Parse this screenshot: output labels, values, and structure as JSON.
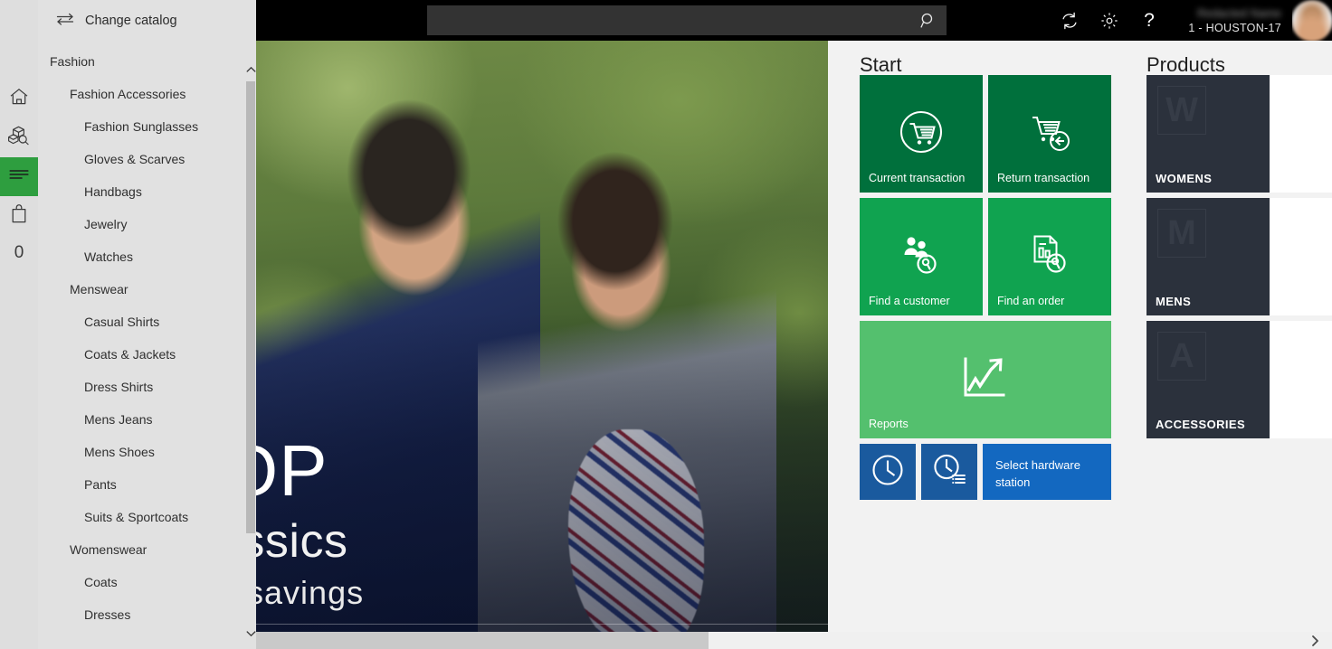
{
  "topbar": {
    "search": {
      "value": "",
      "placeholder": "",
      "icon": "search-icon"
    },
    "refresh_icon": "refresh-icon",
    "settings_icon": "gear-icon",
    "help_icon": "question-mark-icon",
    "user_name": "Redacted Name",
    "user_terminal": "1 - HOUSTON-17"
  },
  "rail": {
    "home_icon": "home-icon",
    "products_icon": "product-search-icon",
    "list_icon": "list-lines-icon",
    "bag_icon": "shopping-bag-icon",
    "count": "0"
  },
  "nav": {
    "menu_icon": "hamburger-icon",
    "swap_icon": "swap-arrows-icon",
    "change_catalog_label": "Change catalog",
    "items": [
      {
        "label": "Fashion",
        "level": 0
      },
      {
        "label": "Fashion Accessories",
        "level": 1
      },
      {
        "label": "Fashion Sunglasses",
        "level": 2
      },
      {
        "label": "Gloves & Scarves",
        "level": 2
      },
      {
        "label": "Handbags",
        "level": 2
      },
      {
        "label": "Jewelry",
        "level": 2
      },
      {
        "label": "Watches",
        "level": 2
      },
      {
        "label": "Menswear",
        "level": 1
      },
      {
        "label": "Casual Shirts",
        "level": 2
      },
      {
        "label": "Coats & Jackets",
        "level": 2
      },
      {
        "label": "Dress Shirts",
        "level": 2
      },
      {
        "label": "Mens Jeans",
        "level": 2
      },
      {
        "label": "Mens Shoes",
        "level": 2
      },
      {
        "label": "Pants",
        "level": 2
      },
      {
        "label": "Suits & Sportcoats",
        "level": 2
      },
      {
        "label": "Womenswear",
        "level": 1
      },
      {
        "label": "Coats",
        "level": 2
      },
      {
        "label": "Dresses",
        "level": 2
      }
    ],
    "scroll_up_icon": "chevron-up-icon",
    "scroll_down_icon": "chevron-down-icon"
  },
  "hero": {
    "line1": "OP",
    "line2": "assics",
    "line3": "e  savings"
  },
  "start": {
    "title": "Start",
    "tiles": [
      {
        "label": "Current transaction",
        "icon": "cart-circle-icon",
        "color": "#00703c"
      },
      {
        "label": "Return transaction",
        "icon": "cart-return-icon",
        "color": "#00703c"
      },
      {
        "label": "Find a customer",
        "icon": "customer-search-icon",
        "color": "#10a350"
      },
      {
        "label": "Find an order",
        "icon": "order-search-icon",
        "color": "#10a350"
      },
      {
        "label": "Reports",
        "icon": "chart-arrow-icon",
        "color": "#54c06e"
      }
    ],
    "utility_tiles": [
      {
        "label": "",
        "icon": "clock-icon",
        "color": "#1a5a9e"
      },
      {
        "label": "",
        "icon": "clock-list-icon",
        "color": "#1a5a9e"
      },
      {
        "label": "Select hardware station",
        "icon": "",
        "color": "#1368c0"
      }
    ]
  },
  "products": {
    "title": "Products",
    "tiles": [
      {
        "label": "WOMENS",
        "initial": "W"
      },
      {
        "label": "MENS",
        "initial": "M"
      },
      {
        "label": "ACCESSORIES",
        "initial": "A"
      }
    ]
  },
  "bottom": {
    "next_icon": "chevron-right-icon"
  },
  "colors": {
    "accent_green": "#2e9e3f",
    "tile_green_dark": "#00703c",
    "tile_green_mid": "#10a350",
    "tile_green_light": "#54c06e",
    "tile_blue_dark": "#1a5a9e",
    "tile_blue": "#1368c0",
    "product_dark": "#2b313c",
    "topbar_black": "#000000",
    "panel_bg": "#f2f2f2",
    "nav_bg": "#e1e1e1"
  }
}
